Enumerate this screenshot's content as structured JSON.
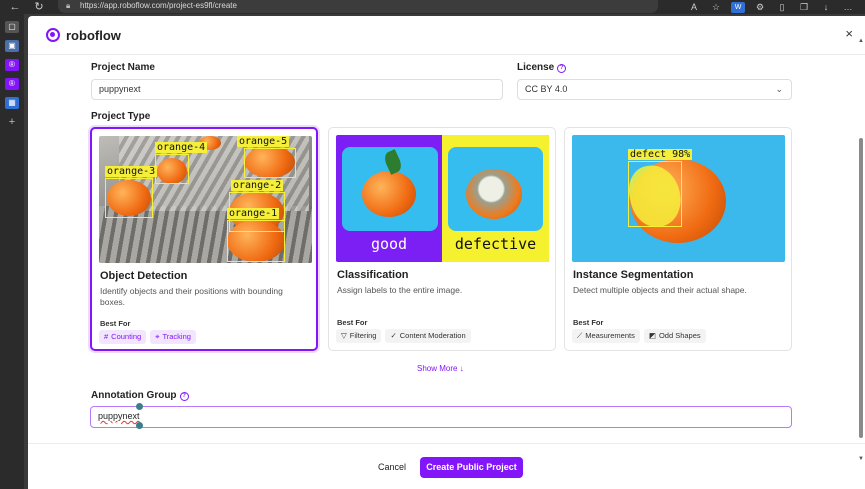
{
  "browser": {
    "url": "https://app.roboflow.com/project-es9fl/create",
    "icons": [
      "back-icon",
      "refresh-icon",
      "read-aloud-icon",
      "favorite-icon",
      "extension-icon",
      "puzzle-icon",
      "split-screen-icon",
      "collections-icon",
      "download-icon",
      "more-icon"
    ]
  },
  "modal": {
    "brand": "roboflow",
    "close_label": "×",
    "project_name": {
      "label": "Project Name",
      "value": "puppynext"
    },
    "license": {
      "label": "License",
      "value": "CC BY 4.0"
    },
    "project_type_label": "Project Type",
    "cards": [
      {
        "title": "Object Detection",
        "description": "Identify objects and their positions with bounding boxes.",
        "best_for_label": "Best For",
        "tags": [
          {
            "icon": "#",
            "label": "Counting"
          },
          {
            "icon": "⌖",
            "label": "Tracking"
          }
        ],
        "image_labels": [
          "orange-4",
          "orange-5",
          "orange-3",
          "orange-2",
          "orange-1"
        ]
      },
      {
        "title": "Classification",
        "description": "Assign labels to the entire image.",
        "best_for_label": "Best For",
        "tags": [
          {
            "icon": "▽",
            "label": "Filtering"
          },
          {
            "icon": "✓",
            "label": "Content Moderation"
          }
        ],
        "image_labels": [
          "good",
          "defective"
        ]
      },
      {
        "title": "Instance Segmentation",
        "description": "Detect multiple objects and their actual shape.",
        "best_for_label": "Best For",
        "tags": [
          {
            "icon": "⟋",
            "label": "Measurements"
          },
          {
            "icon": "◩",
            "label": "Odd Shapes"
          }
        ],
        "image_labels": [
          "defect 98%"
        ]
      }
    ],
    "show_more": "Show More ↓",
    "annotation_group": {
      "label": "Annotation Group",
      "value": "puppynext"
    },
    "cancel_label": "Cancel",
    "create_label": "Create Public Project"
  },
  "colors": {
    "accent": "#8315f9",
    "annotation_yellow": "#f5ee3a"
  }
}
